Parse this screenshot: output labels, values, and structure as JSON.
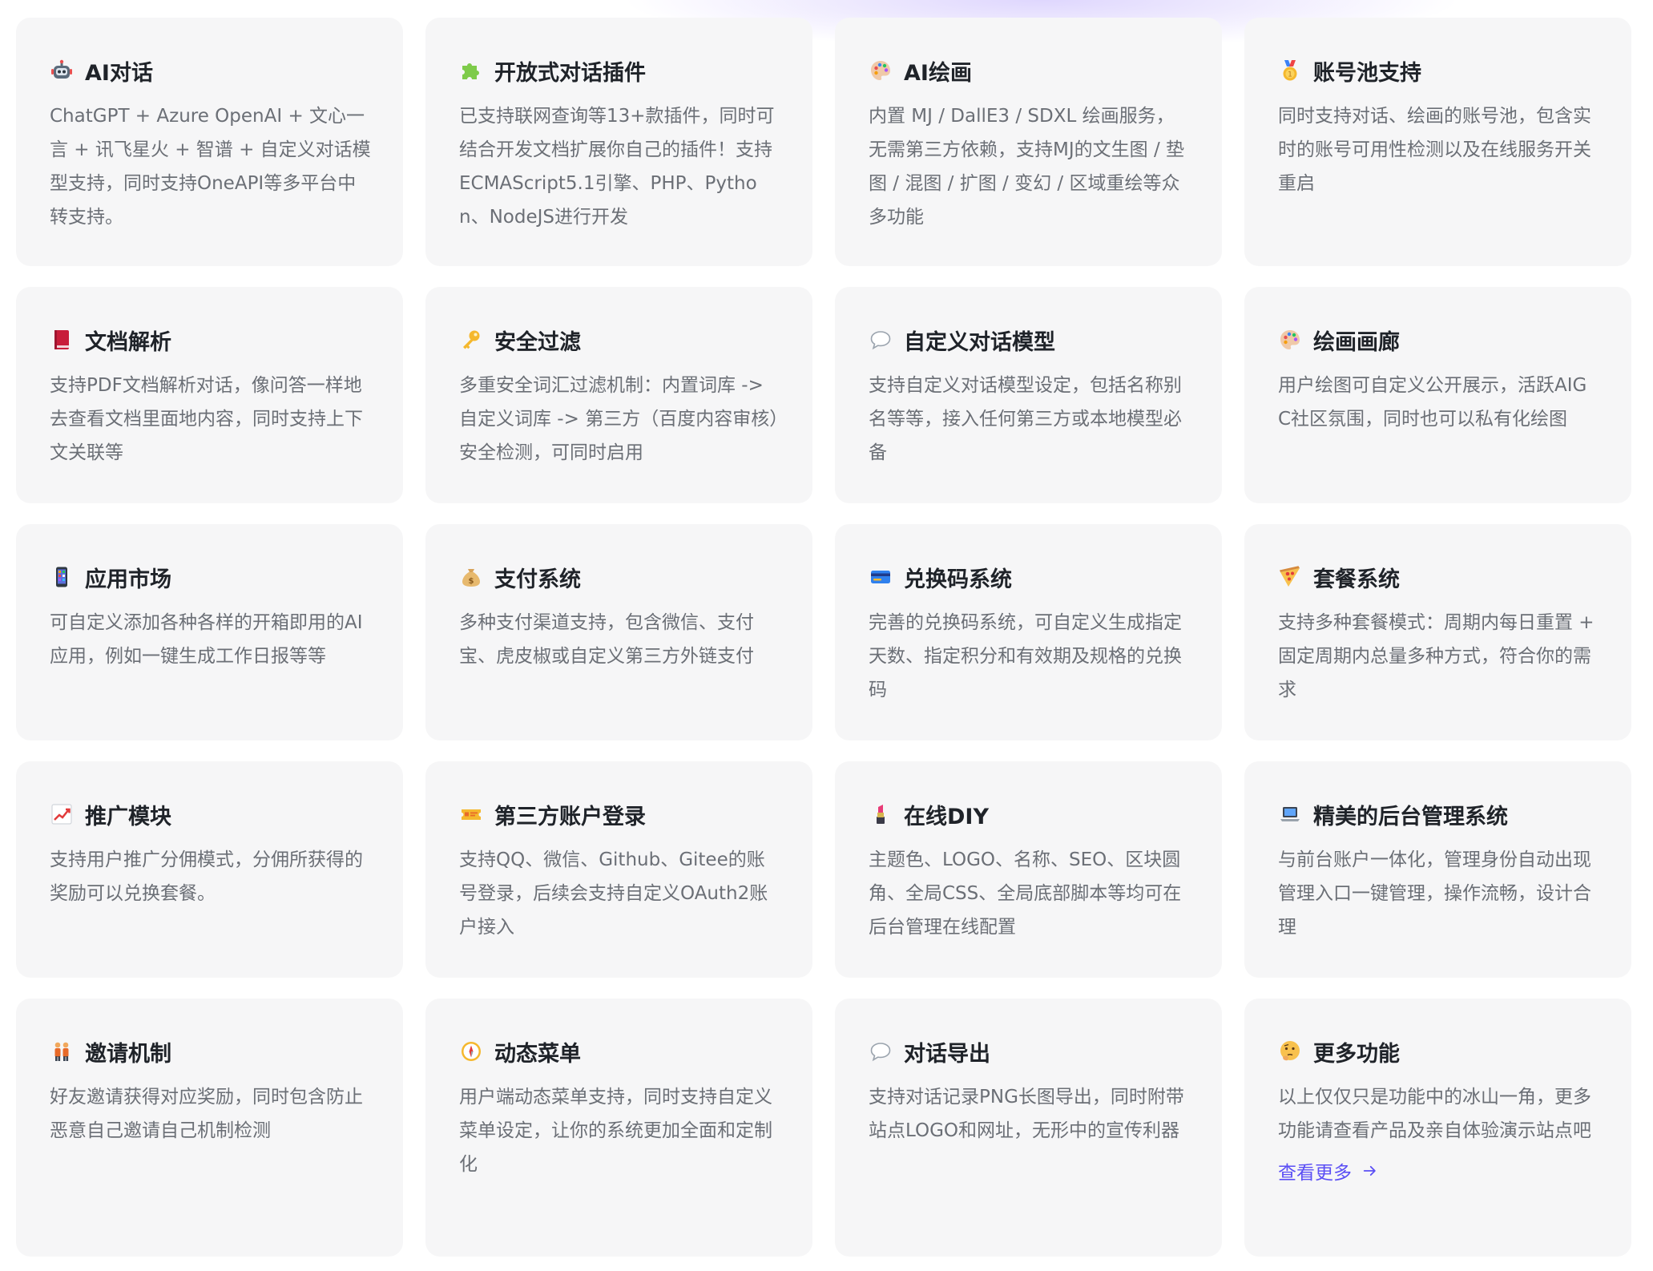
{
  "features": [
    {
      "icon": "robot-icon",
      "title": "AI对话",
      "desc": "ChatGPT + Azure OpenAI + 文心一言 + 讯飞星火 + 智谱 + 自定义对话模型支持，同时支持OneAPI等多平台中转支持。"
    },
    {
      "icon": "puzzle-icon",
      "title": "开放式对话插件",
      "desc": "已支持联网查询等13+款插件，同时可结合开发文档扩展你自己的插件！支持ECMAScript5.1引擎、PHP、Python、NodeJS进行开发"
    },
    {
      "icon": "palette-icon",
      "title": "AI绘画",
      "desc": "内置 MJ / DallE3 / SDXL 绘画服务，无需第三方依赖，支持MJ的文生图 / 垫图 / 混图 / 扩图 / 变幻 / 区域重绘等众多功能"
    },
    {
      "icon": "medal-icon",
      "title": "账号池支持",
      "desc": "同时支持对话、绘画的账号池，包含实时的账号可用性检测以及在线服务开关重启"
    },
    {
      "icon": "book-icon",
      "title": "文档解析",
      "desc": "支持PDF文档解析对话，像问答一样地去查看文档里面地内容，同时支持上下文关联等"
    },
    {
      "icon": "key-icon",
      "title": "安全过滤",
      "desc": "多重安全词汇过滤机制：内置词库 -> 自定义词库 -> 第三方（百度内容审核）安全检测，可同时启用"
    },
    {
      "icon": "speech-bubble-icon",
      "title": "自定义对话模型",
      "desc": "支持自定义对话模型设定，包括名称别名等等，接入任何第三方或本地模型必备"
    },
    {
      "icon": "palette-icon",
      "title": "绘画画廊",
      "desc": "用户绘图可自定义公开展示，活跃AIGC社区氛围，同时也可以私有化绘图"
    },
    {
      "icon": "phone-app-icon",
      "title": "应用市场",
      "desc": "可自定义添加各种各样的开箱即用的AI应用，例如一键生成工作日报等等"
    },
    {
      "icon": "money-bag-icon",
      "title": "支付系统",
      "desc": "多种支付渠道支持，包含微信、支付宝、虎皮椒或自定义第三方外链支付"
    },
    {
      "icon": "credit-card-icon",
      "title": "兑换码系统",
      "desc": "完善的兑换码系统，可自定义生成指定天数、指定积分和有效期及规格的兑换码"
    },
    {
      "icon": "pizza-icon",
      "title": "套餐系统",
      "desc": "支持多种套餐模式：周期内每日重置 + 固定周期内总量多种方式，符合你的需求"
    },
    {
      "icon": "chart-up-icon",
      "title": "推广模块",
      "desc": "支持用户推广分佣模式，分佣所获得的奖励可以兑换套餐。"
    },
    {
      "icon": "ticket-icon",
      "title": "第三方账户登录",
      "desc": "支持QQ、微信、Github、Gitee的账号登录，后续会支持自定义OAuth2账户接入"
    },
    {
      "icon": "lipstick-icon",
      "title": "在线DIY",
      "desc": "主题色、LOGO、名称、SEO、区块圆角、全局CSS、全局底部脚本等均可在后台管理在线配置"
    },
    {
      "icon": "laptop-icon",
      "title": "精美的后台管理系统",
      "desc": "与前台账户一体化，管理身份自动出现管理入口一键管理，操作流畅，设计合理"
    },
    {
      "icon": "people-icon",
      "title": "邀请机制",
      "desc": "好友邀请获得对应奖励，同时包含防止恶意自己邀请自己机制检测"
    },
    {
      "icon": "compass-icon",
      "title": "动态菜单",
      "desc": "用户端动态菜单支持，同时支持自定义菜单设定，让你的系统更加全面和定制化"
    },
    {
      "icon": "speech-bubble-icon",
      "title": "对话导出",
      "desc": "支持对话记录PNG长图导出，同时附带站点LOGO和网址，无形中的宣传利器"
    },
    {
      "icon": "thinking-face-icon",
      "title": "更多功能",
      "desc": "以上仅仅只是功能中的冰山一角，更多功能请查看产品及亲自体验演示站点吧"
    }
  ],
  "more_link": {
    "label": "查看更多",
    "icon": "arrow-right-icon",
    "color": "#5b4ff5"
  },
  "colors": {
    "card_bg": "#f6f6f7",
    "title": "#1f2329",
    "desc": "#6b6f76"
  }
}
